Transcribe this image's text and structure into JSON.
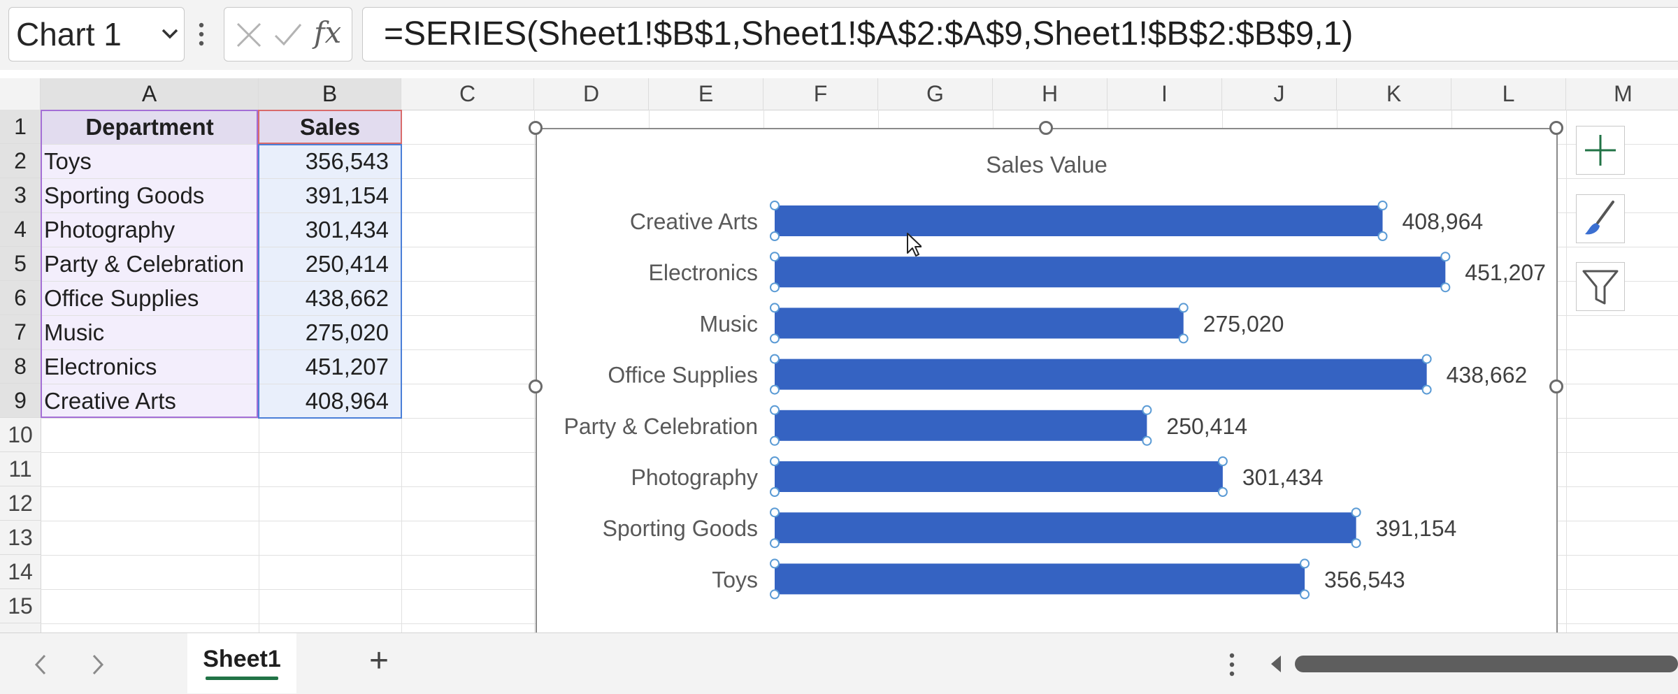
{
  "name_box": {
    "value": "Chart 1"
  },
  "formula_bar": {
    "formula": "=SERIES(Sheet1!$B$1,Sheet1!$A$2:$A$9,Sheet1!$B$2:$B$9,1)",
    "fx_label": "fx"
  },
  "columns": [
    "A",
    "B",
    "C",
    "D",
    "E",
    "F",
    "G",
    "H",
    "I",
    "J",
    "K",
    "L",
    "M"
  ],
  "rows": [
    "1",
    "2",
    "3",
    "4",
    "5",
    "6",
    "7",
    "8",
    "9",
    "10",
    "11",
    "12",
    "13",
    "14",
    "15"
  ],
  "table": {
    "headers": [
      "Department",
      "Sales"
    ],
    "rows": [
      [
        "Toys",
        "356,543"
      ],
      [
        "Sporting Goods",
        "391,154"
      ],
      [
        "Photography",
        "301,434"
      ],
      [
        "Party & Celebration",
        "250,414"
      ],
      [
        "Office Supplies",
        "438,662"
      ],
      [
        "Music",
        "275,020"
      ],
      [
        "Electronics",
        "451,207"
      ],
      [
        "Creative Arts",
        "408,964"
      ]
    ]
  },
  "chart_data": {
    "type": "bar",
    "orientation": "horizontal",
    "title": "Sales Value",
    "categories": [
      "Creative Arts",
      "Electronics",
      "Music",
      "Office Supplies",
      "Party & Celebration",
      "Photography",
      "Sporting Goods",
      "Toys"
    ],
    "values": [
      408964,
      451207,
      275020,
      438662,
      250414,
      301434,
      391154,
      356543
    ],
    "data_labels": [
      "408,964",
      "451,207",
      "275,020",
      "438,662",
      "250,414",
      "301,434",
      "391,154",
      "356,543"
    ],
    "xlim": [
      0,
      460000
    ],
    "gridlines": false,
    "legend": "none",
    "bar_color": "#3563c2",
    "selected": true
  },
  "chart_tools": [
    "chart-elements-icon",
    "chart-styles-icon",
    "chart-filters-icon"
  ],
  "sheet_tabs": {
    "active": "Sheet1",
    "add_label": "+"
  },
  "colors": {
    "accent_green": "#217346",
    "header_fill": "#f3f3f3",
    "dept_fill": "#f3eefc",
    "sales_fill": "#e9effb"
  }
}
